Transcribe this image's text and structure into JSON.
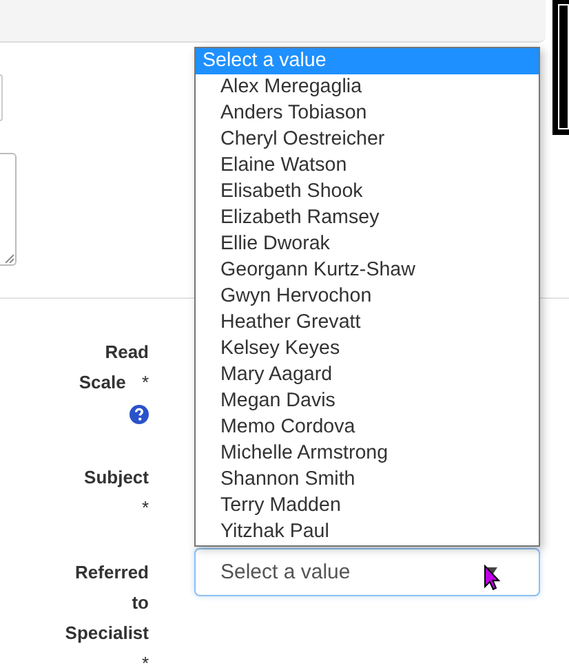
{
  "fields": [
    {
      "label": "Read Scale",
      "required_mark": "*",
      "help": true
    },
    {
      "label": "Subject",
      "required_mark": "*"
    },
    {
      "label": "Referred to Specialist",
      "required_mark": "*",
      "select": {
        "placeholder": "Select a value"
      }
    }
  ],
  "dropdown": {
    "options": [
      {
        "label": "Select a value",
        "kind": "placeholder",
        "selected": true
      },
      {
        "label": "Alex Meregaglia",
        "kind": "option",
        "selected": false
      },
      {
        "label": "Anders Tobiason",
        "kind": "option",
        "selected": false
      },
      {
        "label": "Cheryl Oestreicher",
        "kind": "option",
        "selected": false
      },
      {
        "label": "Elaine Watson",
        "kind": "option",
        "selected": false
      },
      {
        "label": "Elisabeth Shook",
        "kind": "option",
        "selected": false
      },
      {
        "label": "Elizabeth Ramsey",
        "kind": "option",
        "selected": false
      },
      {
        "label": "Ellie Dworak",
        "kind": "option",
        "selected": false
      },
      {
        "label": "Georgann Kurtz-Shaw",
        "kind": "option",
        "selected": false
      },
      {
        "label": "Gwyn Hervochon",
        "kind": "option",
        "selected": false
      },
      {
        "label": "Heather Grevatt",
        "kind": "option",
        "selected": false
      },
      {
        "label": "Kelsey Keyes",
        "kind": "option",
        "selected": false
      },
      {
        "label": "Mary Aagard",
        "kind": "option",
        "selected": false
      },
      {
        "label": "Megan Davis",
        "kind": "option",
        "selected": false
      },
      {
        "label": "Memo Cordova",
        "kind": "option",
        "selected": false
      },
      {
        "label": "Michelle Armstrong",
        "kind": "option",
        "selected": false
      },
      {
        "label": "Shannon Smith",
        "kind": "option",
        "selected": false
      },
      {
        "label": "Terry Madden",
        "kind": "option",
        "selected": false
      },
      {
        "label": "Yitzhak Paul",
        "kind": "option",
        "selected": false
      }
    ]
  }
}
